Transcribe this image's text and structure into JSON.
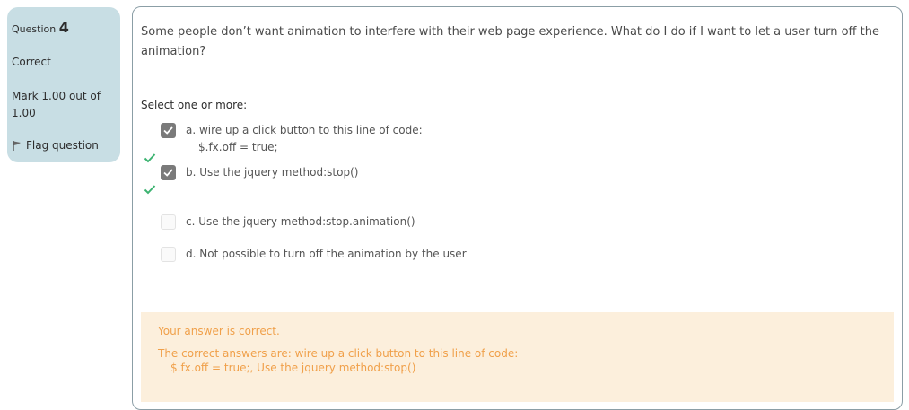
{
  "question_info": {
    "label": "Question",
    "number": "4",
    "state": "Correct",
    "grade": "Mark 1.00 out of 1.00",
    "flag_label": "Flag question"
  },
  "question": {
    "text": "Some people don’t want animation to interfere with their web page experience. What do I do if I want to let a user turn off the animation?",
    "prompt": "Select one or more:",
    "options": [
      {
        "label": "a. wire up a click button to this line of code:",
        "code": "$.fx.off = true;",
        "checked": true,
        "correct": true
      },
      {
        "label": "b. Use the jquery method:stop()",
        "checked": true,
        "correct": true
      },
      {
        "label": "c. Use the jquery method:stop.animation()",
        "checked": false
      },
      {
        "label": "d. Not possible to turn off the animation by the user",
        "checked": false
      }
    ]
  },
  "feedback": {
    "general": "Your answer is correct.",
    "correct_answers_line1": "The correct answers are: wire up a click button to this line of code:",
    "correct_answers_line2": "$.fx.off = true;, Use the jquery method:stop()"
  },
  "colors": {
    "info_bg": "#c8dee4",
    "checkbox_checked": "#7a7a7a",
    "tick_green": "#3cb371",
    "feedback_bg": "#fcefdc",
    "feedback_text": "#f0a04a"
  }
}
